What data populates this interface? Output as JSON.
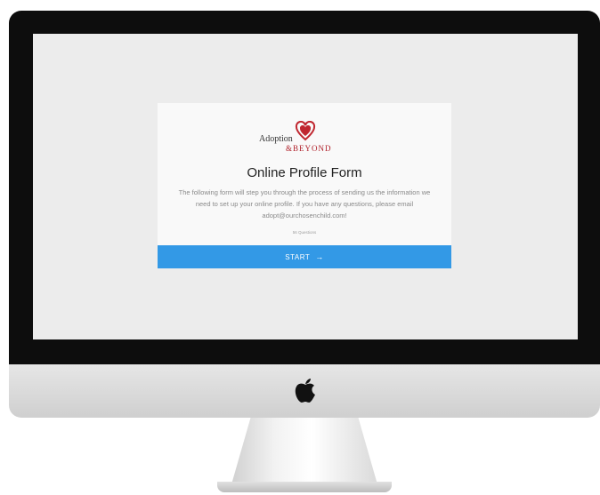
{
  "form": {
    "logo_line1": "Adoption",
    "logo_line2": "&BEYOND",
    "title": "Online Profile Form",
    "description": "The following form will step you through the process of sending us the information we need to set up your online profile. If you have any questions, please email adopt@ourchosenchild.com!",
    "question_count": "56 Questions",
    "start_label": "START",
    "arrow": "→"
  },
  "colors": {
    "accent": "#3399e6",
    "logo_red": "#b0202a",
    "screen_bg": "#ececec"
  },
  "icons": [
    "heart-icon",
    "arrow-right-icon",
    "apple-logo-icon"
  ]
}
